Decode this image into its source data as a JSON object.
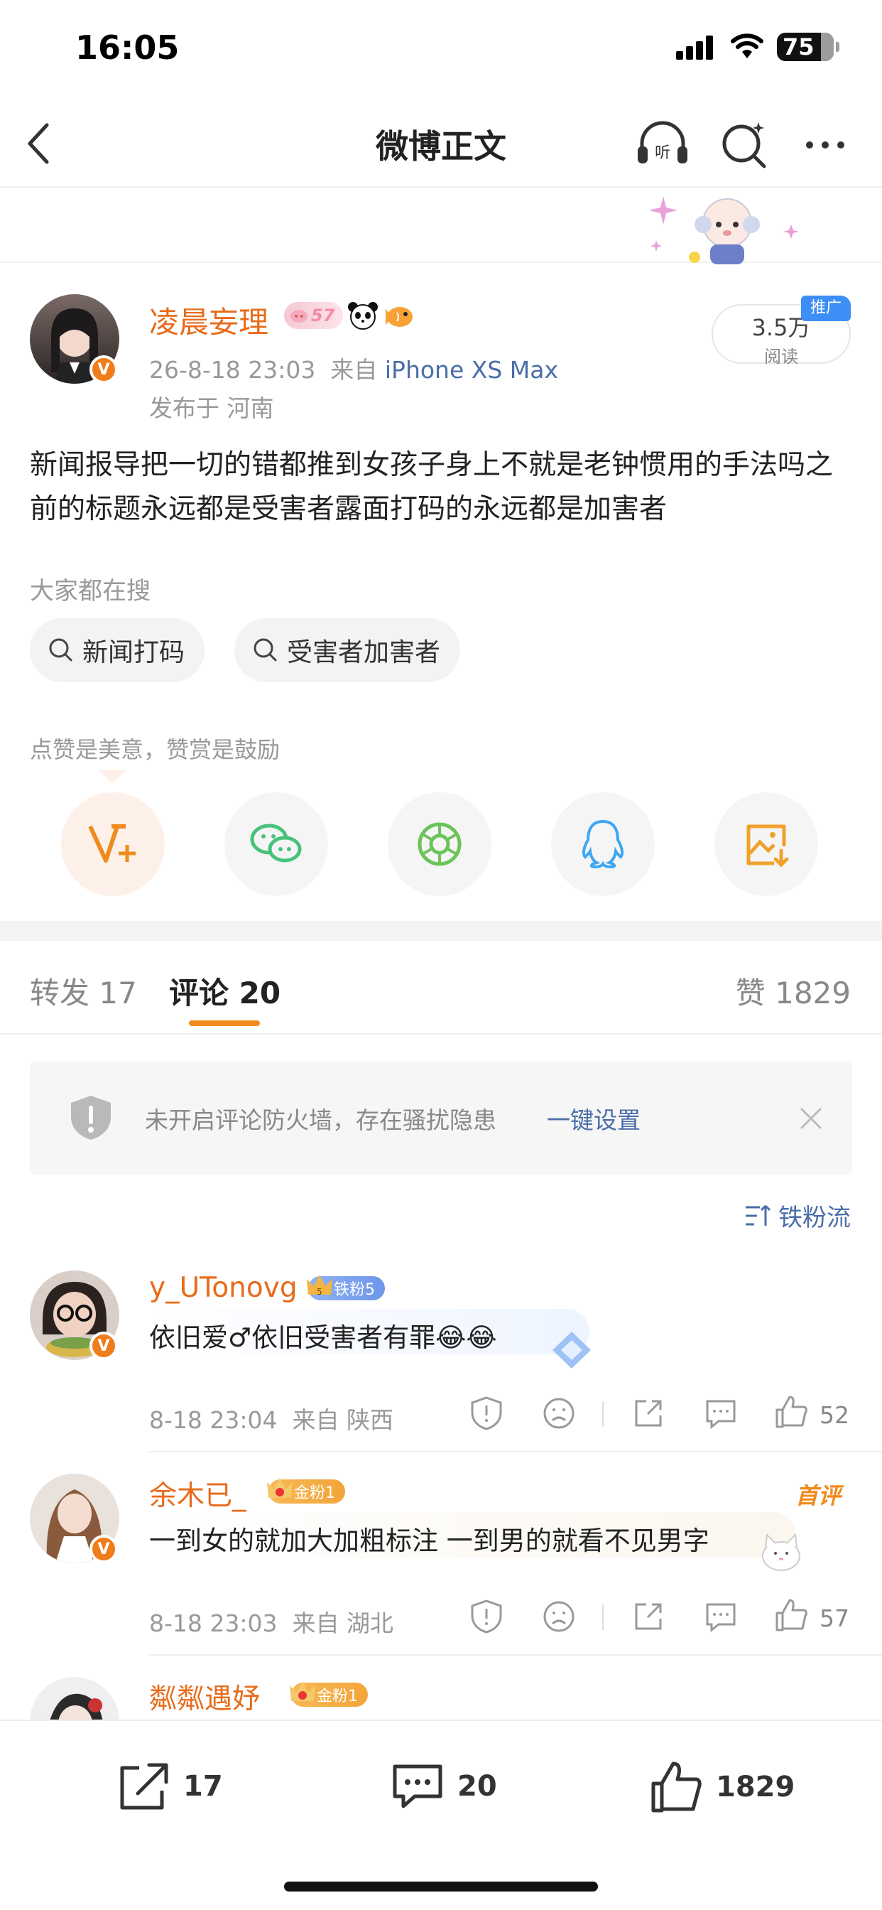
{
  "status_bar": {
    "time": "16:05",
    "battery": "75"
  },
  "nav": {
    "title": "微博正文"
  },
  "post": {
    "author": "凌晨妄理",
    "level_badge": "57",
    "timestamp": "26-8-18 23:03",
    "from_label": "来自",
    "device": "iPhone XS Max",
    "location": "发布于 河南",
    "reads_count": "3.5万",
    "reads_label": "阅读",
    "ad_label": "推广",
    "content": "新闻报导把一切的错都推到女孩子身上不就是老钟惯用的手法吗之前的标题永远都是受害者露面打码的永远都是加害者"
  },
  "search": {
    "title": "大家都在搜",
    "chips": [
      "新闻打码",
      "受害者加害者"
    ]
  },
  "encourage_text": "点赞是美意，赞赏是鼓励",
  "tabs": {
    "repost_label": "转发",
    "repost_count": "17",
    "comment_label": "评论",
    "comment_count": "20",
    "like_label": "赞",
    "like_count": "1829"
  },
  "notice": {
    "text": "未开启评论防火墙，存在骚扰隐患",
    "link": "一键设置"
  },
  "sort_label": "铁粉流",
  "comments": [
    {
      "name": "y_UTonovg",
      "fan": "铁粉5",
      "text": "依旧爱♂依旧受害者有罪😂😂",
      "time": "8-18 23:04",
      "loc": "来自 陕西",
      "likes": "52"
    },
    {
      "name": "余木已_",
      "fan": "金粉1",
      "tag": "首评",
      "text": "一到女的就加大加粗标注 一到男的就看不见男字",
      "time": "8-18 23:03",
      "loc": "来自 湖北",
      "likes": "57"
    },
    {
      "name": "粼粼遇妤",
      "fan": "金粉1"
    }
  ],
  "bottom_bar": {
    "repost": "17",
    "comment": "20",
    "like": "1829"
  }
}
